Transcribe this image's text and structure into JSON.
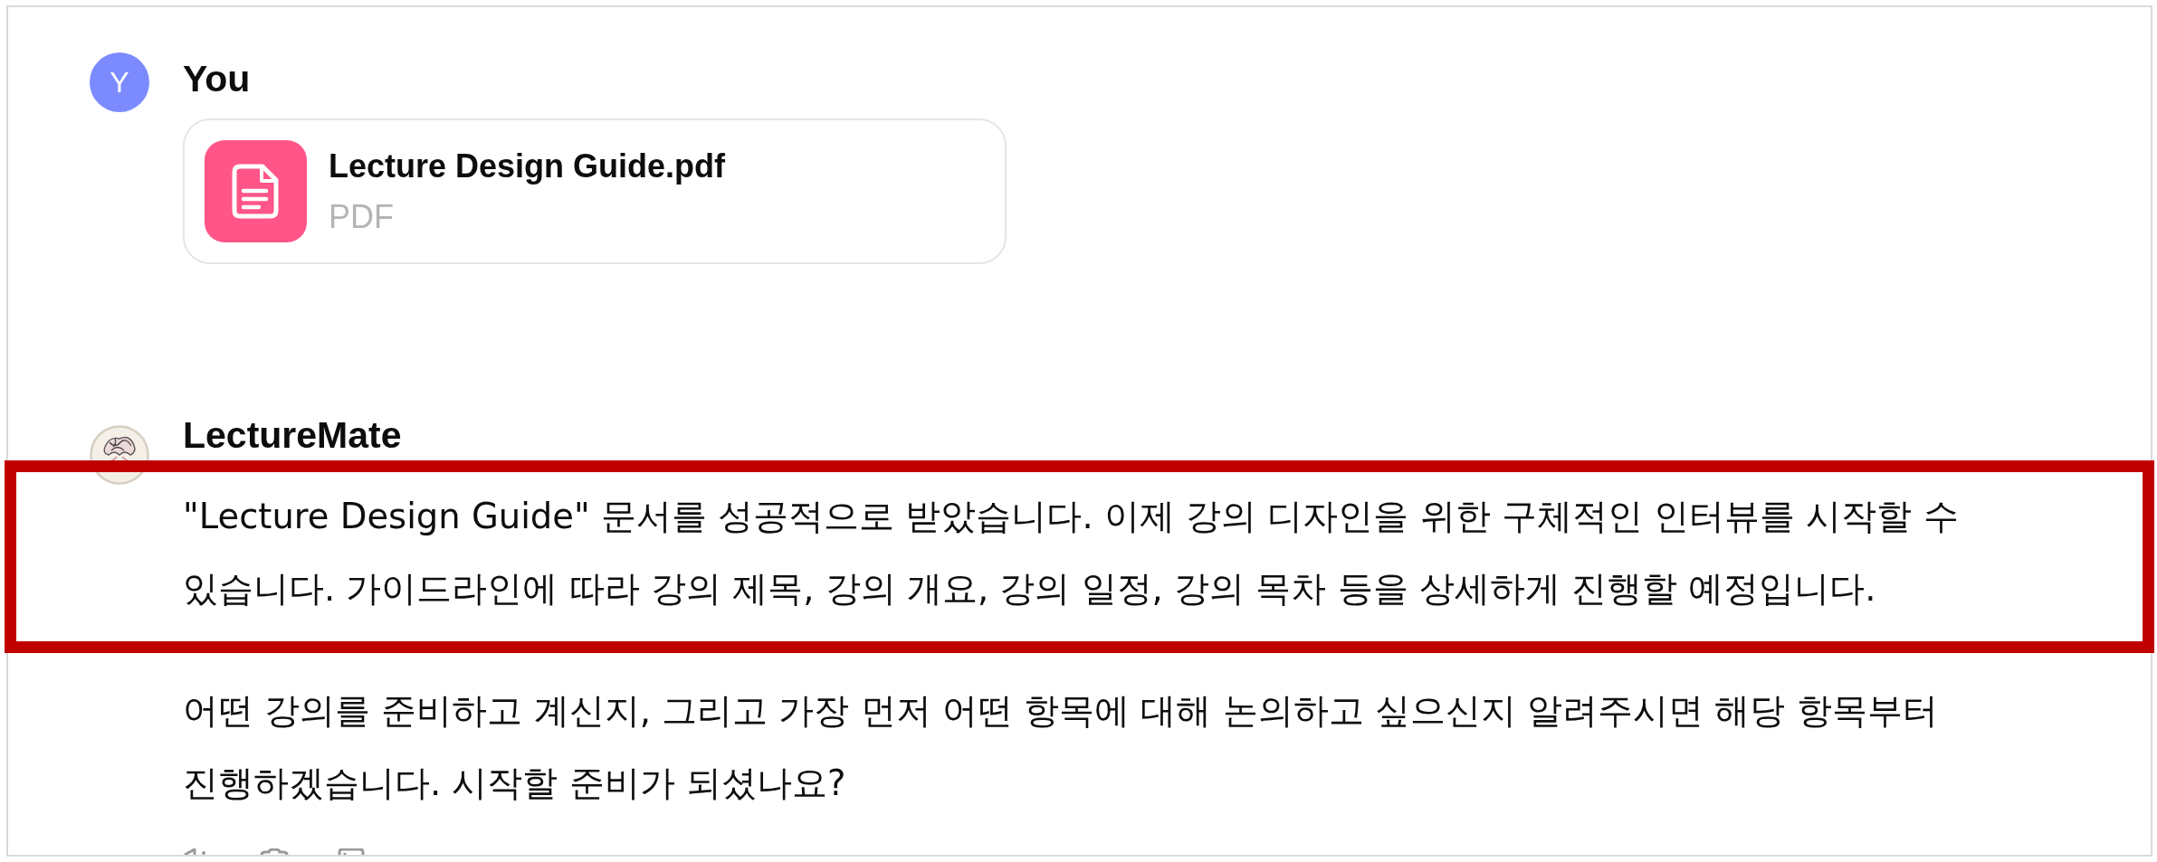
{
  "conversation": [
    {
      "author": "You",
      "avatar": {
        "kind": "initial",
        "letter": "Y"
      },
      "action_bar": false,
      "attachments": [
        {
          "name": "Lecture Design Guide.pdf",
          "file_type": "PDF"
        }
      ]
    },
    {
      "author": "LectureMate",
      "avatar": {
        "kind": "emblem"
      },
      "action_bar": true,
      "paragraphs": [
        {
          "text": "\"Lecture Design Guide\" 문서를 성공적으로 받았습니다. 이제 강의 디자인을 위한 구체적인 인터뷰를 시작할 수 있습니다. 가이드라인에 따라 강의 제목, 강의 개요, 강의 일정, 강의 목차 등을 상세하게 진행할 예정입니다.",
          "highlighted": true
        },
        {
          "text": "어떤 강의를 준비하고 계신지, 그리고 가장 먼저 어떤 항목에 대해 논의하고 싶으신지 알려주시면 해당 항목부터 진행하겠습니다. 시작할 준비가 되셨나요?",
          "highlighted": false
        }
      ]
    }
  ]
}
